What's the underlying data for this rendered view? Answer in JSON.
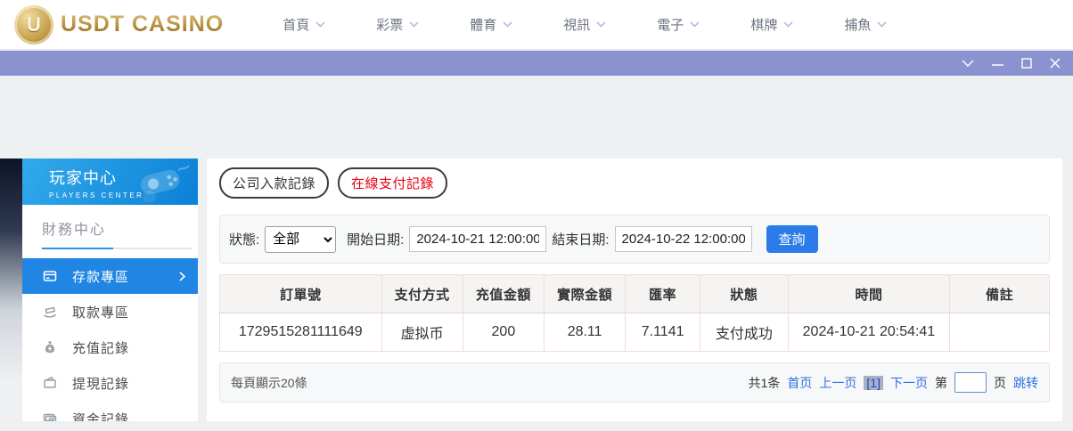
{
  "header": {
    "logo": {
      "badge": "U",
      "text": "USDT CASINO"
    },
    "nav": [
      "首頁",
      "彩票",
      "體育",
      "視訊",
      "電子",
      "棋牌",
      "捕魚"
    ]
  },
  "sidebar": {
    "title": "玩家中心",
    "subtitle": "PLAYERS CENTER",
    "section": "財務中心",
    "items": [
      {
        "label": "存款專區"
      },
      {
        "label": "取款專區"
      },
      {
        "label": "充值記錄"
      },
      {
        "label": "提現記錄"
      },
      {
        "label": "資金記錄"
      }
    ]
  },
  "main": {
    "tabs": [
      {
        "label": "公司入款記錄"
      },
      {
        "label": "在線支付記錄"
      }
    ],
    "filters": {
      "status_label": "狀態:",
      "status_value": "全部",
      "start_label": "開始日期:",
      "start_value": "2024-10-21 12:00:00",
      "end_label": "結束日期:",
      "end_value": "2024-10-22 12:00:00",
      "search_button": "查詢"
    },
    "table": {
      "headers": [
        "訂單號",
        "支付方式",
        "充值金額",
        "實際金額",
        "匯率",
        "狀態",
        "時間",
        "備註"
      ],
      "rows": [
        [
          "1729515281111649",
          "虚拟币",
          "200",
          "28.11",
          "7.1141",
          "支付成功",
          "2024-10-21 20:54:41",
          ""
        ]
      ]
    },
    "pagination": {
      "page_size_text": "每頁顯示20條",
      "total_text": "共1条",
      "first": "首页",
      "prev": "上一页",
      "current": "[1]",
      "next": "下一页",
      "jump_prefix": "第",
      "jump_suffix": "页",
      "jump_action": "跳转"
    }
  },
  "colors": {
    "titlebar_purple": "#8a92d0",
    "sidebar_header_blue": "#0b80d6",
    "active_item_blue": "#2186e3",
    "query_button_blue": "#2b7ce9",
    "link_blue": "#2f6fe0",
    "active_tab_red": "#e60012",
    "table_border_pink": "#f2dbdb",
    "logo_gold": "#b68f3e"
  }
}
